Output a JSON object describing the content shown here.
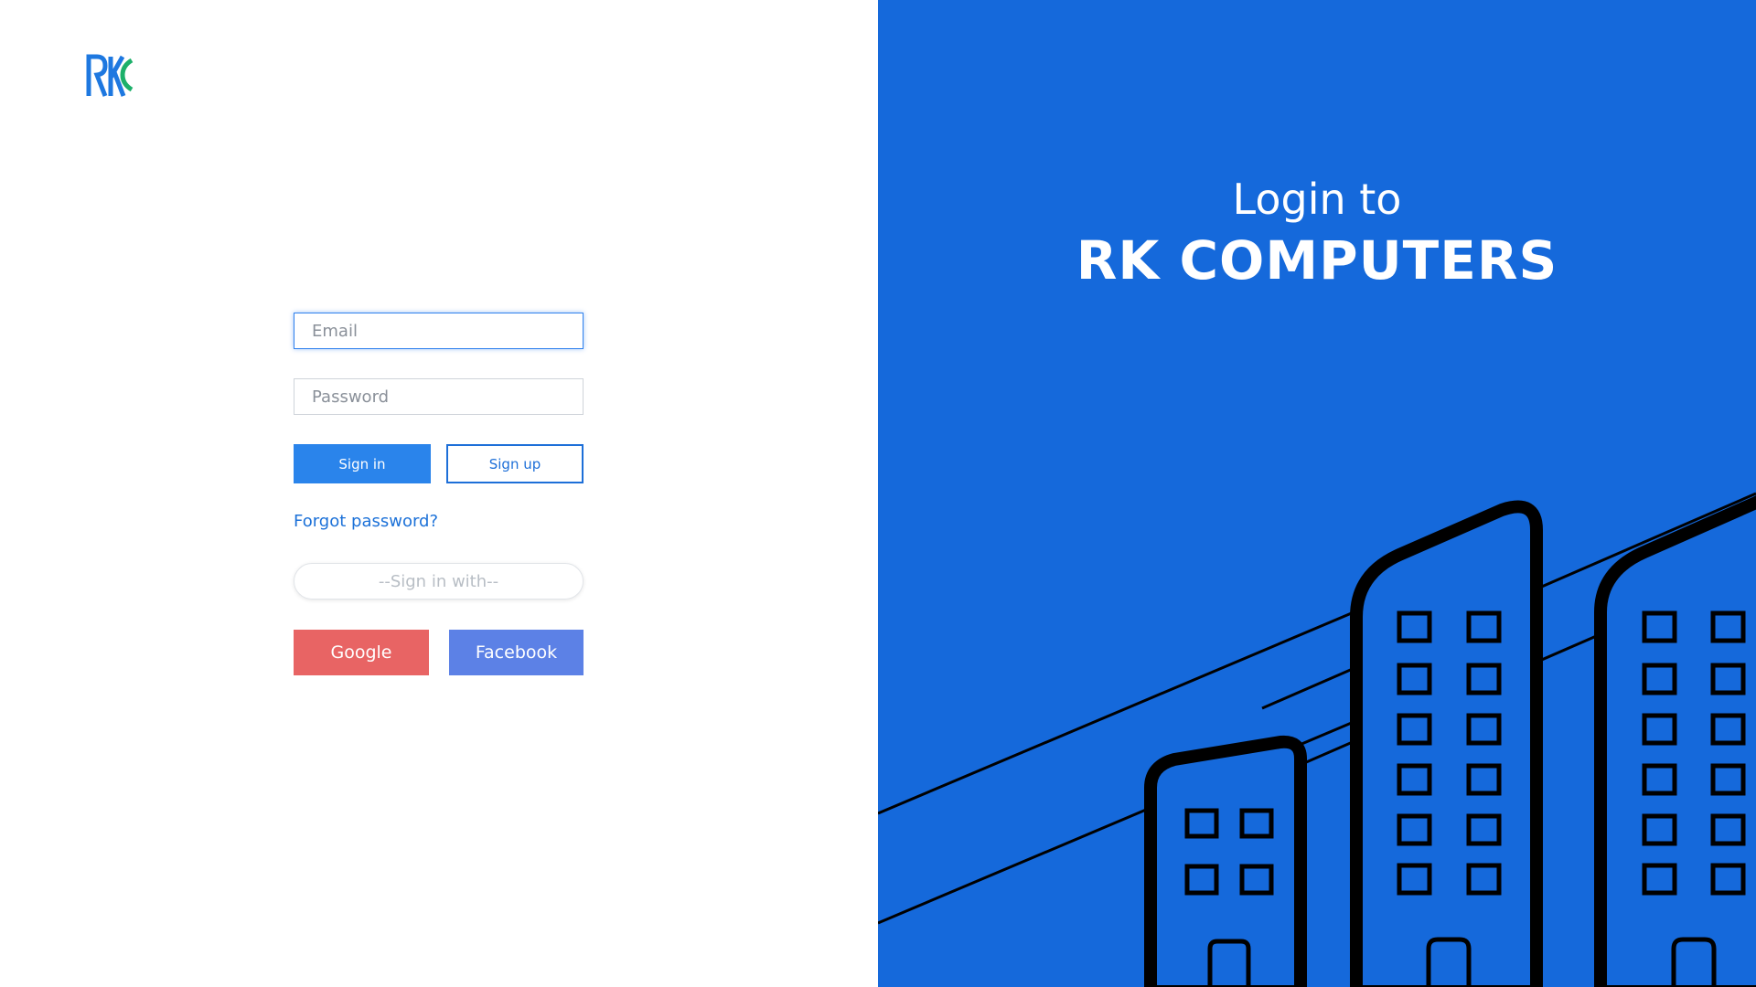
{
  "brand": {
    "logo_text": "RKC",
    "logo_colors": {
      "primary": "#1e78e0",
      "secondary": "#1cb06a"
    }
  },
  "login_form": {
    "email_placeholder": "Email",
    "password_placeholder": "Password",
    "signin_label": "Sign in",
    "signup_label": "Sign up",
    "forgot_label": "Forgot password?",
    "divider_label": "--Sign in with--",
    "google_label": "Google",
    "facebook_label": "Facebook"
  },
  "hero": {
    "subtitle": "Login to",
    "title": "RK COMPUTERS"
  },
  "colors": {
    "accent_blue": "#1569db",
    "signin_button": "#2a84eb",
    "google": "#e86464",
    "facebook": "#5c81e6"
  },
  "illustration": {
    "icon": "city-buildings-illustration"
  }
}
